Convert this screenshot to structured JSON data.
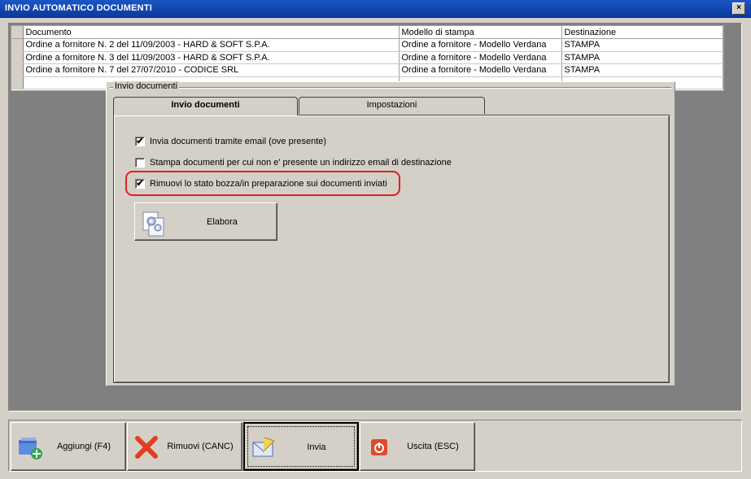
{
  "window": {
    "title": "INVIO AUTOMATICO DOCUMENTI",
    "close_glyph": "×"
  },
  "grid": {
    "headers": [
      "Documento",
      "Modello di stampa",
      "Destinazione"
    ],
    "rows": [
      [
        "Ordine a fornitore N. 2 del 11/09/2003 - HARD & SOFT S.P.A.",
        "Ordine a fornitore - Modello Verdana",
        "STAMPA"
      ],
      [
        "Ordine a fornitore N. 3 del 11/09/2003 - HARD & SOFT S.P.A.",
        "Ordine a fornitore - Modello Verdana",
        "STAMPA"
      ],
      [
        "Ordine a fornitore N. 7 del 27/07/2010 - CODICE SRL",
        "Ordine a fornitore - Modello Verdana",
        "STAMPA"
      ]
    ]
  },
  "panel": {
    "legend": "Invio documenti",
    "tabs": [
      {
        "label": "Invio documenti",
        "active": true
      },
      {
        "label": "Impostazioni",
        "active": false
      }
    ],
    "options": [
      {
        "label": "Invia documenti tramite email (ove presente)",
        "checked": true
      },
      {
        "label": "Stampa documenti per cui non e' presente un indirizzo email di destinazione",
        "checked": false
      },
      {
        "label": "Rimuovi lo stato bozza/in preparazione sui documenti inviati",
        "checked": true
      }
    ],
    "check_glyph": "✔",
    "elabora_label": "Elabora",
    "highlight_color": "#e02020"
  },
  "toolbar": {
    "add_label": "Aggiungi (F4)",
    "remove_label": "Rimuovi (CANC)",
    "send_label": "Invia",
    "exit_label": "Uscita (ESC)"
  },
  "colors": {
    "titlebar": "#0a3a9e",
    "face": "#d4d0c8",
    "workspace": "#808080"
  }
}
